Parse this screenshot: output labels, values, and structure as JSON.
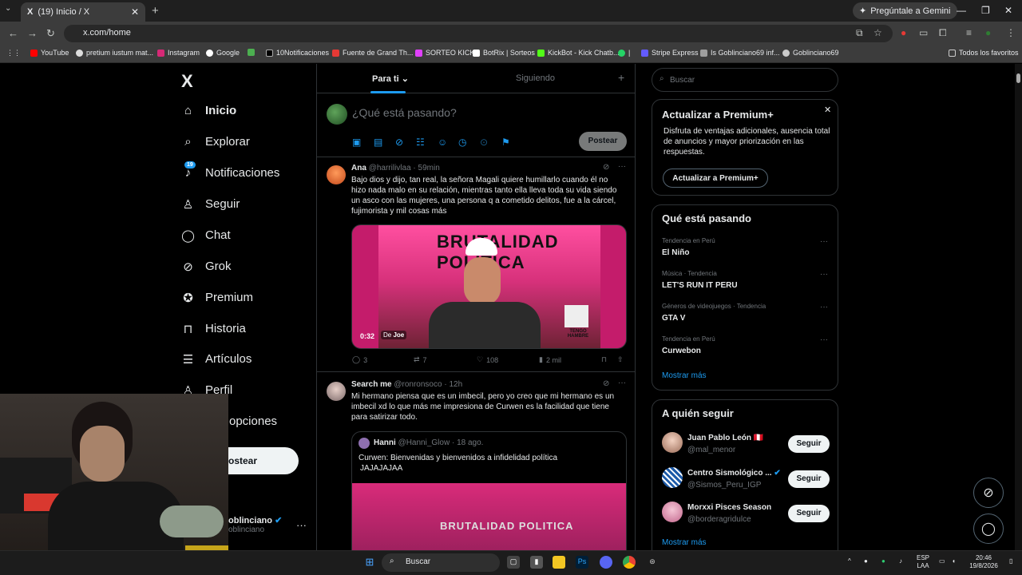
{
  "browser": {
    "tab_title": "(19) Inicio / X",
    "tab_favicon": "X",
    "gemini_button": "Pregúntale a Gemini",
    "url": "x.com/home",
    "bookmarks": [
      "YouTube",
      "pretium iustum mat...",
      "Instagram",
      "Google",
      "10Notificaciones",
      "Fuente de Grand Th...",
      "SORTEO KICK",
      "BotRix | Sorteos",
      "KickBot - Kick Chatb...",
      "Stripe Express",
      "Is Goblinciano69 inf...",
      "Goblinciano69"
    ],
    "bookmarks_extra": "|",
    "all_favorites": "Todos los favoritos"
  },
  "x_nav": {
    "logo": "X",
    "items": [
      {
        "label": "Inicio",
        "icon": "home-icon"
      },
      {
        "label": "Explorar",
        "icon": "search-icon"
      },
      {
        "label": "Notificaciones",
        "icon": "bell-icon"
      },
      {
        "label": "Seguir",
        "icon": "add-user-icon"
      },
      {
        "label": "Chat",
        "icon": "chat-icon"
      },
      {
        "label": "Grok",
        "icon": "grok-icon"
      },
      {
        "label": "Premium",
        "icon": "premium-icon"
      },
      {
        "label": "Historia",
        "icon": "bookmark-icon"
      },
      {
        "label": "Artículos",
        "icon": "articles-icon"
      },
      {
        "label": "Perfil",
        "icon": "profile-icon"
      },
      {
        "label": "opciones",
        "icon": "more-icon"
      }
    ],
    "notif_badge": "19",
    "post_button": "ostear",
    "account_name": "oblinciano",
    "account_handle": "oblinciano"
  },
  "timeline": {
    "tab_for_you": "Para ti",
    "tab_following": "Siguiendo",
    "compose_placeholder": "¿Qué está pasando?",
    "post_button": "Postear",
    "tweets": [
      {
        "name": "Ana",
        "handle": "@harrilivlaa",
        "time": "· 59min",
        "text": "Bajo dios y dijo, tan real, la señora Magali quiere humillarlo cuando él no hizo nada malo en su relación, mientras tanto ella lleva toda su vida siendo un asco con las mujeres, una persona q a cometido delitos, fue a la cárcel, fujimorista y mil cosas más",
        "video_time": "0:32",
        "video_from": "De",
        "video_source": "Joe",
        "video_caption": "TENGO HAMBRE",
        "video_overlay": "BRUTALIDAD POLITICA",
        "replies": "3",
        "reposts": "7",
        "likes": "108",
        "views": "2 mil"
      },
      {
        "name": "Search me",
        "handle": "@ronronsoco",
        "time": "· 12h",
        "text": "Mi hermano piensa que es un imbecil, pero yo creo que mi hermano es un imbecil xd lo que más me impresiona de Curwen es la facilidad que tiene para satirizar todo.",
        "quote_name": "Hanni",
        "quote_handle": "@Hanni_Glow",
        "quote_time": "· 18 ago.",
        "quote_text": "Curwen: Bienvenidas y bienvenidos  a infidelidad política",
        "quote_text2": "JAJAJAJAA",
        "quote_overlay": "BRUTALIDAD POLITICA"
      }
    ]
  },
  "sidebar": {
    "search_placeholder": "Buscar",
    "premium": {
      "title": "Actualizar a Premium+",
      "desc": "Disfruta de ventajas adicionales, ausencia total de anuncios y mayor priorización en las respuestas.",
      "button": "Actualizar a Premium+"
    },
    "trends_title": "Qué está pasando",
    "trends": [
      {
        "context": "Tendencia en Perú",
        "name": "El Niño"
      },
      {
        "context": "Música · Tendencia",
        "name": "LET'S RUN IT PERU"
      },
      {
        "context": "Géneros de videojuegos · Tendencia",
        "name": "GTA V"
      },
      {
        "context": "Tendencia en Perú",
        "name": "Curwebon"
      }
    ],
    "trends_more": "Mostrar más",
    "follow_title": "A quién seguir",
    "follow": [
      {
        "name": "Juan Pablo León 🇵🇪",
        "handle": "@mal_menor",
        "button": "Seguir"
      },
      {
        "name": "Centro Sismológico ...",
        "handle": "@Sismos_Peru_IGP",
        "button": "Seguir"
      },
      {
        "name": "Morxxi Pisces Season",
        "handle": "@borderagridulce",
        "button": "Seguir"
      }
    ],
    "follow_more": "Mostrar más"
  },
  "taskbar": {
    "search": "Buscar",
    "lang": "ESP",
    "lang2": "LAA",
    "time": "20:46",
    "date": "19/8/2026"
  },
  "colors": {
    "accent": "#1d9bf0",
    "background": "#000000",
    "border": "#2f3336",
    "muted": "#71767b"
  }
}
